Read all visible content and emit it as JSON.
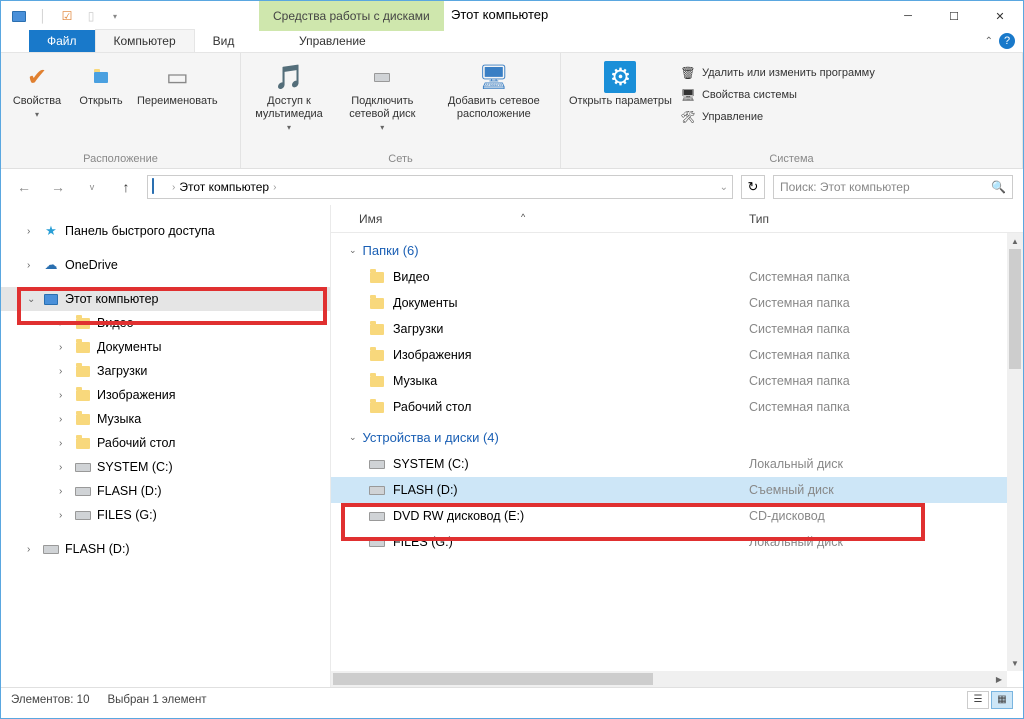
{
  "titlebar": {
    "drive_tools": "Средства работы с дисками",
    "title": "Этот компьютер"
  },
  "tabs": {
    "file": "Файл",
    "computer": "Компьютер",
    "view": "Вид",
    "manage": "Управление"
  },
  "ribbon": {
    "location": {
      "label": "Расположение",
      "properties": "Свойства",
      "open": "Открыть",
      "rename": "Переименовать"
    },
    "network": {
      "label": "Сеть",
      "media": "Доступ к мультимедиа",
      "map_drive": "Подключить сетевой диск",
      "add_location": "Добавить сетевое расположение"
    },
    "system": {
      "label": "Система",
      "open_settings": "Открыть параметры",
      "uninstall": "Удалить или изменить программу",
      "sys_props": "Свойства системы",
      "manage": "Управление"
    }
  },
  "nav": {
    "breadcrumb": "Этот компьютер",
    "search_placeholder": "Поиск: Этот компьютер"
  },
  "tree": {
    "quick_access": "Панель быстрого доступа",
    "onedrive": "OneDrive",
    "this_pc": "Этот компьютер",
    "videos": "Видео",
    "documents": "Документы",
    "downloads": "Загрузки",
    "pictures": "Изображения",
    "music": "Музыка",
    "desktop": "Рабочий стол",
    "system_c": "SYSTEM (C:)",
    "flash_d": "FLASH (D:)",
    "files_g": "FILES (G:)",
    "flash_d2": "FLASH (D:)"
  },
  "list": {
    "col_name": "Имя",
    "col_type": "Тип",
    "section_folders": "Папки (6)",
    "section_drives": "Устройства и диски (4)",
    "folders": [
      {
        "name": "Видео",
        "type": "Системная папка"
      },
      {
        "name": "Документы",
        "type": "Системная папка"
      },
      {
        "name": "Загрузки",
        "type": "Системная папка"
      },
      {
        "name": "Изображения",
        "type": "Системная папка"
      },
      {
        "name": "Музыка",
        "type": "Системная папка"
      },
      {
        "name": "Рабочий стол",
        "type": "Системная папка"
      }
    ],
    "drives": [
      {
        "name": "SYSTEM (C:)",
        "type": "Локальный диск"
      },
      {
        "name": "FLASH (D:)",
        "type": "Съемный диск"
      },
      {
        "name": "DVD RW дисковод (E:)",
        "type": "CD-дисковод"
      },
      {
        "name": "FILES (G:)",
        "type": "Локальный диск"
      }
    ]
  },
  "status": {
    "count": "Элементов: 10",
    "selected": "Выбран 1 элемент"
  }
}
